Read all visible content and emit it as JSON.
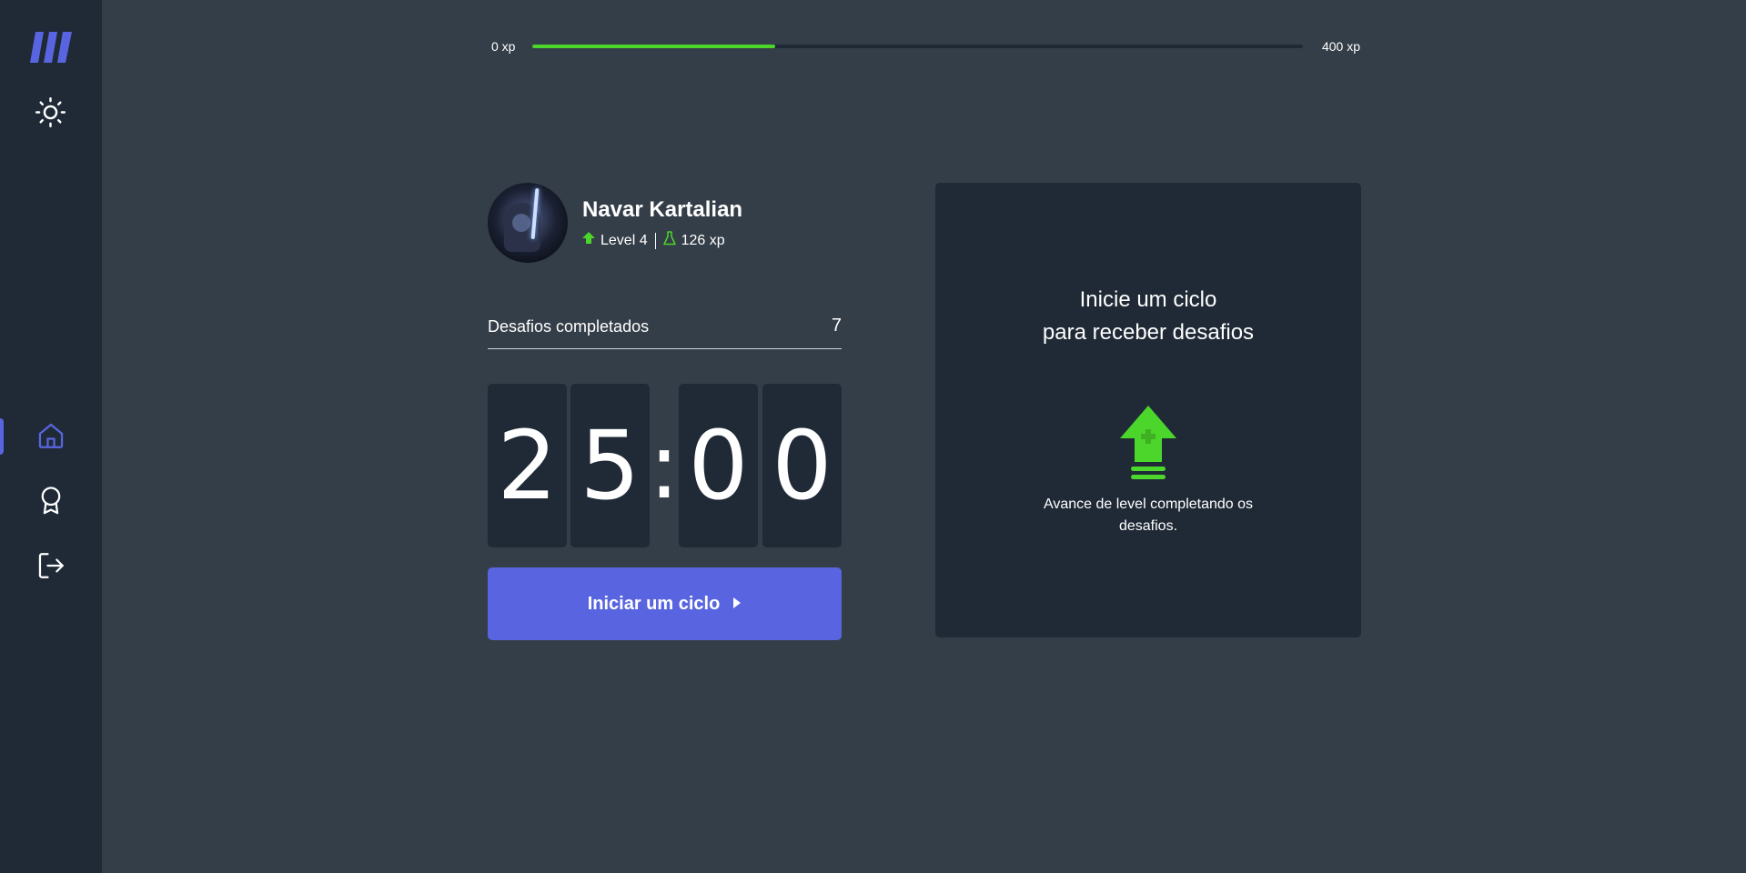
{
  "sidebar": {
    "logo_icon": "move-it-logo",
    "theme_icon": "sun-icon",
    "items": [
      {
        "name": "home",
        "icon": "home-icon",
        "active": true
      },
      {
        "name": "leaderboard",
        "icon": "award-icon",
        "active": false
      },
      {
        "name": "logout",
        "icon": "logout-icon",
        "active": false
      }
    ]
  },
  "xp": {
    "min_label": "0 xp",
    "max_label": "400 xp",
    "progress_fraction": 0.315
  },
  "profile": {
    "name": "Navar Kartalian",
    "level": "Level 4",
    "xp": "126 xp"
  },
  "challenges": {
    "label": "Desafios completados",
    "count": "7"
  },
  "countdown": {
    "minute_left": "2",
    "minute_right": "5",
    "separator": ":",
    "second_left": "0",
    "second_right": "0"
  },
  "start_button": {
    "label": "Iniciar um ciclo"
  },
  "challenge_box": {
    "title_line1": "Inicie um ciclo",
    "title_line2": "para receber desafios",
    "description": "Avance de level completando os desafios."
  },
  "colors": {
    "background": "#343e48",
    "panel": "#1f2a36",
    "accent": "#5965e0",
    "green": "#4cd62b"
  }
}
